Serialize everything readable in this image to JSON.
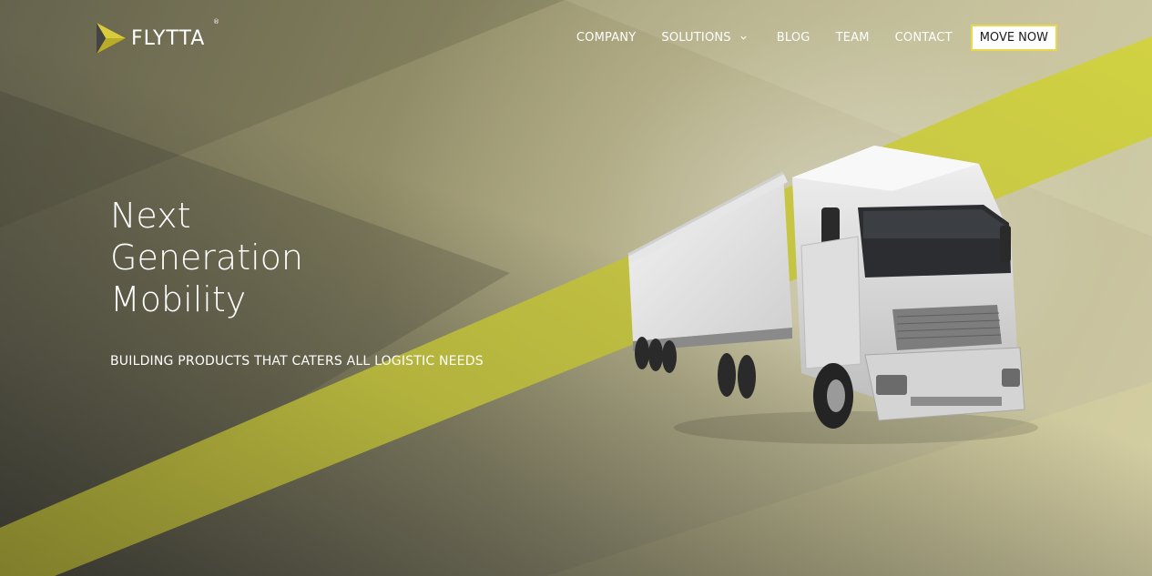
{
  "brand": {
    "name": "FLYTTA",
    "registered_mark": "®",
    "accent_color": "#c8c83a"
  },
  "nav": {
    "items": [
      {
        "label": "COMPANY"
      },
      {
        "label": "SOLUTIONS",
        "has_dropdown": true
      },
      {
        "label": "BLOG"
      },
      {
        "label": "TEAM"
      },
      {
        "label": "CONTACT"
      }
    ],
    "cta_label": "MOVE NOW"
  },
  "hero": {
    "headline_lines": [
      "Next",
      "Generation",
      "Mobility"
    ],
    "subtitle": "BUILDING PRODUCTS THAT CATERS ALL LOGISTIC NEEDS",
    "image": "white-truck"
  }
}
